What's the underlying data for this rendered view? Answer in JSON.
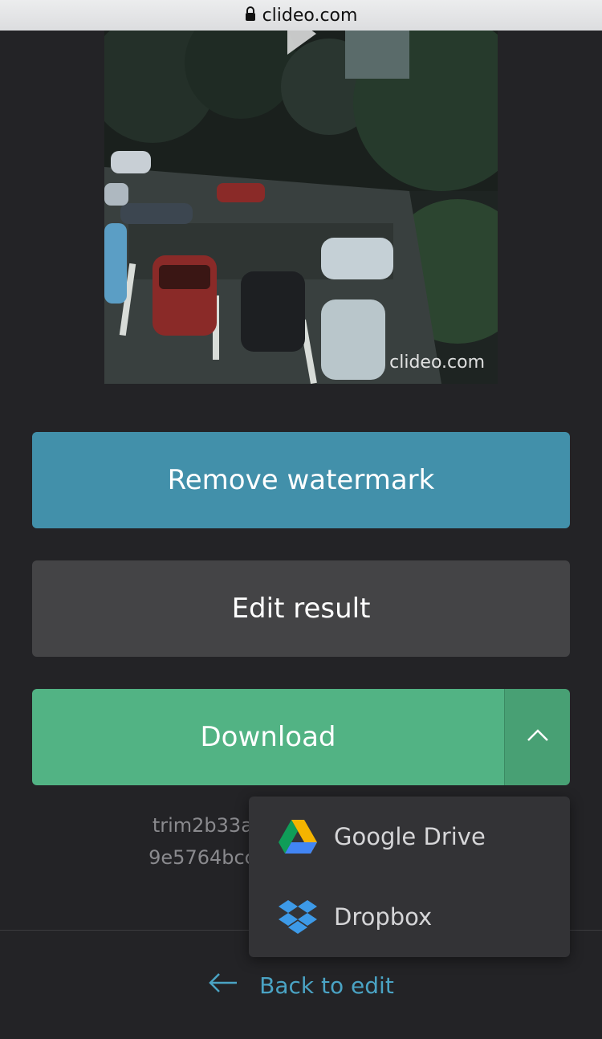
{
  "browser": {
    "url": "clideo.com"
  },
  "video": {
    "watermark": "clideo.com"
  },
  "actions": {
    "remove_watermark": "Remove watermark",
    "edit_result": "Edit result",
    "download": "Download"
  },
  "file": {
    "line1": "trim2b33a7",
    "line2": "9e5764bcceb0_mFs"
  },
  "dropdown": {
    "items": [
      {
        "label": "Google Drive",
        "icon": "google-drive-icon"
      },
      {
        "label": "Dropbox",
        "icon": "dropbox-icon"
      }
    ]
  },
  "footer": {
    "back_label": "Back to edit"
  },
  "colors": {
    "remove_watermark": "#4290aa",
    "edit_result": "#444446",
    "download": "#52b384",
    "link": "#4aa3c4",
    "background": "#232326"
  }
}
